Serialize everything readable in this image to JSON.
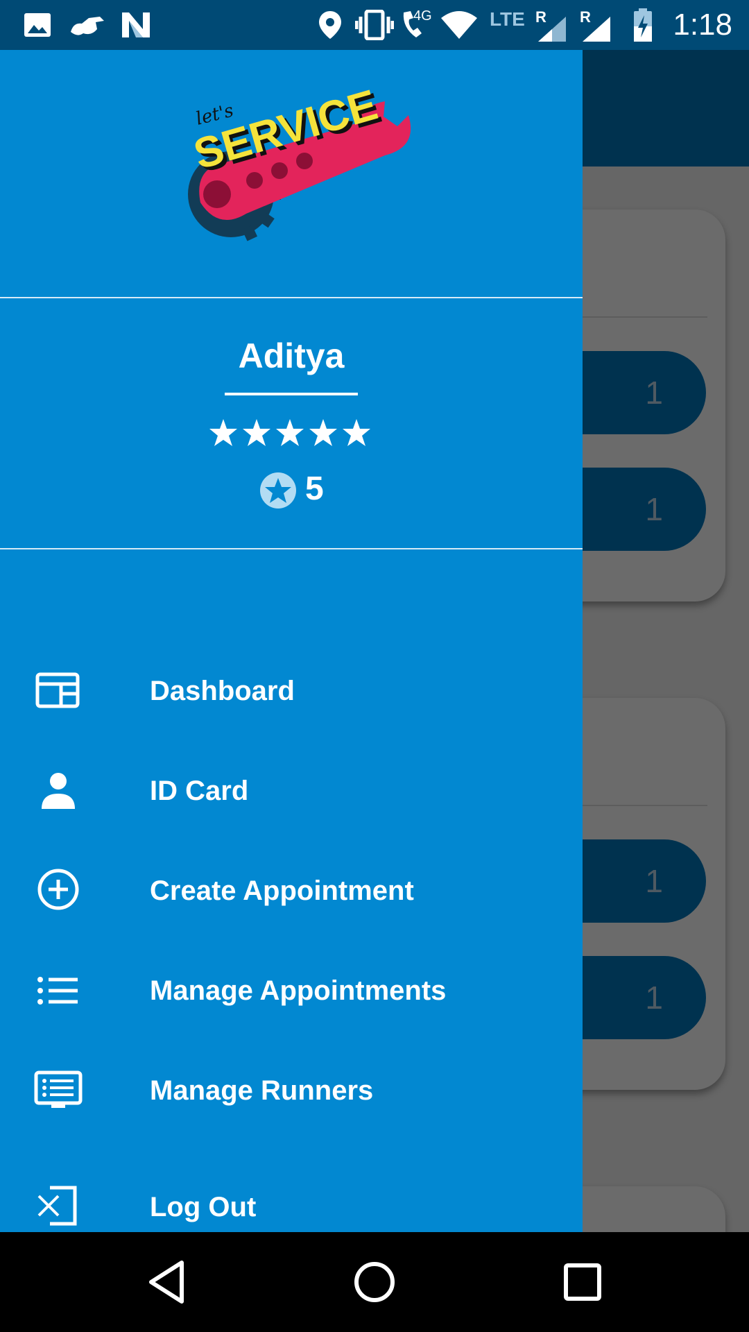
{
  "status_bar": {
    "time": "1:18",
    "network_labels": [
      "4G",
      "LTE",
      "R",
      "R"
    ]
  },
  "drawer": {
    "logo_text": "let's SERVICE",
    "user_name": "Aditya",
    "star_count": 5,
    "rating_value": "5",
    "menu": [
      {
        "label": "Dashboard",
        "icon": "dashboard-icon"
      },
      {
        "label": "ID Card",
        "icon": "person-icon"
      },
      {
        "label": "Create Appointment",
        "icon": "add-circle-icon"
      },
      {
        "label": "Manage Appointments",
        "icon": "list-icon"
      },
      {
        "label": "Manage Runners",
        "icon": "monitor-list-icon"
      },
      {
        "label": "Log Out",
        "icon": "logout-icon"
      }
    ]
  },
  "background": {
    "pill_values": [
      "1",
      "1",
      "1",
      "1"
    ]
  },
  "colors": {
    "drawer": "#0288d1",
    "status_bar": "#004a75",
    "accent_yellow": "#f5e33b",
    "logo_red": "#e3245b"
  }
}
